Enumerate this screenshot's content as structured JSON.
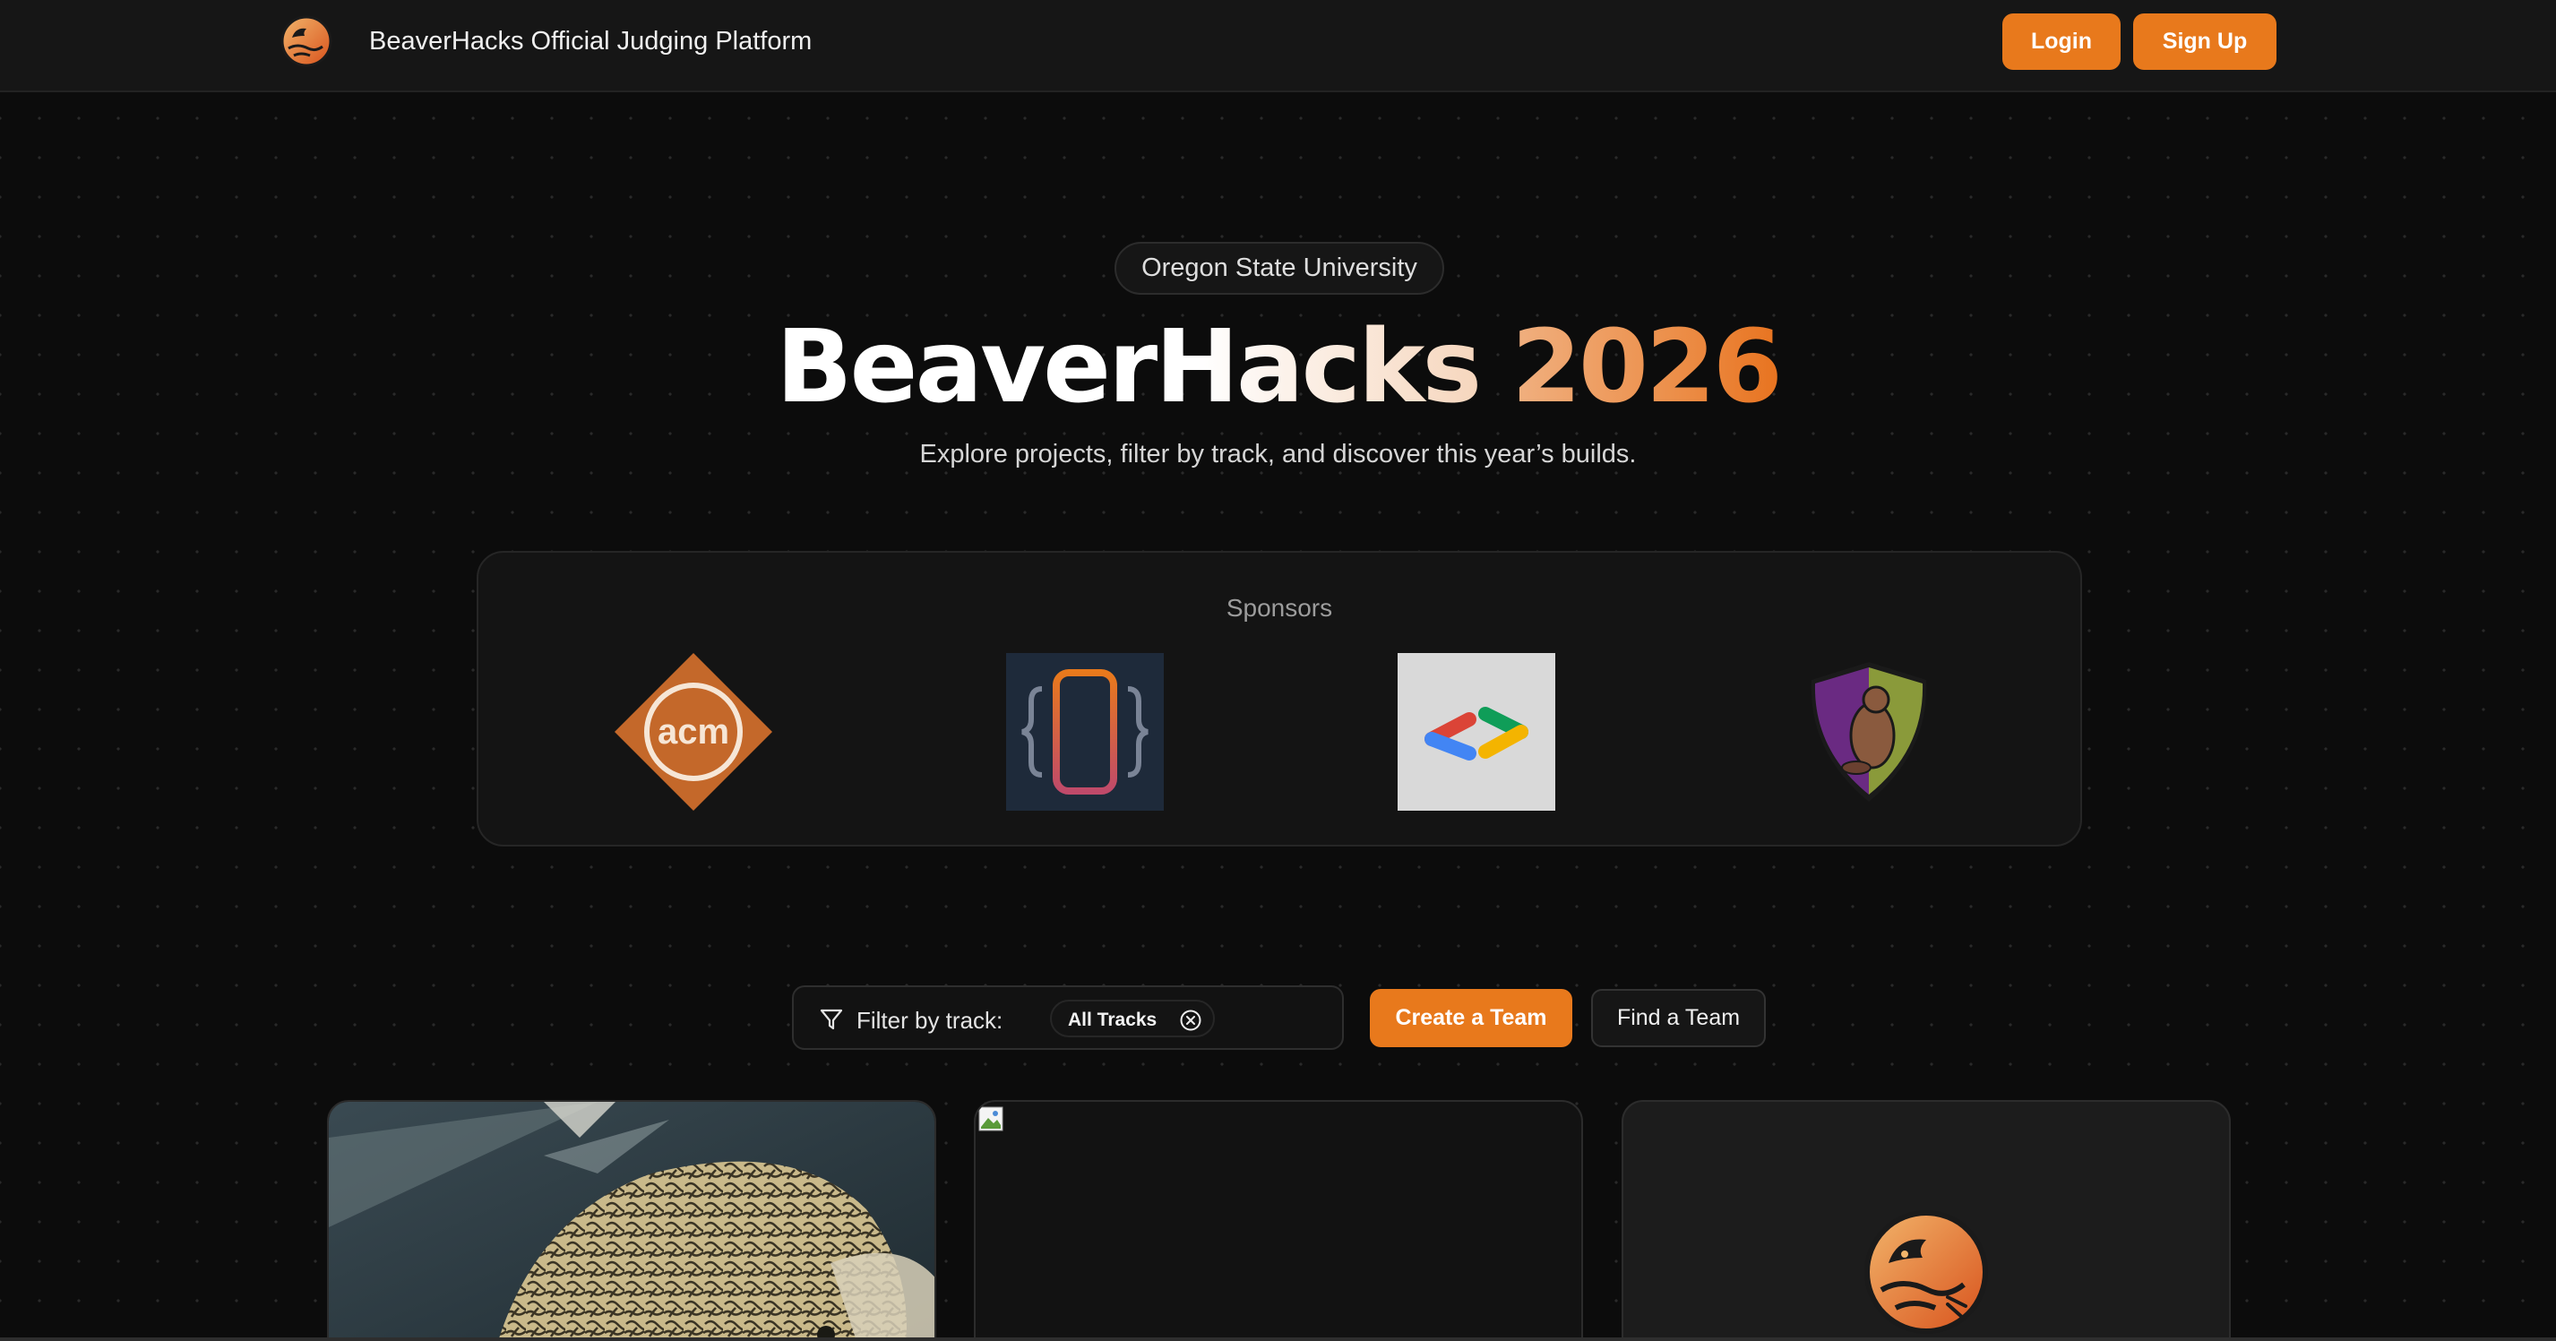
{
  "navbar": {
    "title": "BeaverHacks Official Judging Platform",
    "logo_icon": "beaver-logo-icon",
    "login_label": "Login",
    "signup_label": "Sign Up"
  },
  "hero": {
    "badge": "Oregon State University",
    "title_main": "BeaverHacks",
    "title_year": "2026",
    "subtitle": "Explore projects, filter by track, and discover this year’s builds."
  },
  "sponsors": {
    "label": "Sponsors",
    "logos": [
      {
        "name": "acm",
        "text": "acm",
        "color": "#c4682a"
      },
      {
        "name": "app-dev-club-logo-icon",
        "color": "#1e2a3a"
      },
      {
        "name": "google-developer-logo-icon",
        "color": "#d9d9d9"
      },
      {
        "name": "osu-security-club-logo-icon",
        "color": "#8a9a3a"
      }
    ]
  },
  "filter": {
    "label": "Filter by track:",
    "selected_track": "All Tracks",
    "create_team_label": "Create a Team",
    "find_team_label": "Find a Team"
  },
  "colors": {
    "accent": "#e8791c",
    "background": "#0c0c0c",
    "navbar": "#161616"
  },
  "projects": [
    {
      "image": "pufferfish-photo"
    },
    {
      "image": "broken-image-icon"
    },
    {
      "image": "beaver-logo-icon"
    }
  ]
}
